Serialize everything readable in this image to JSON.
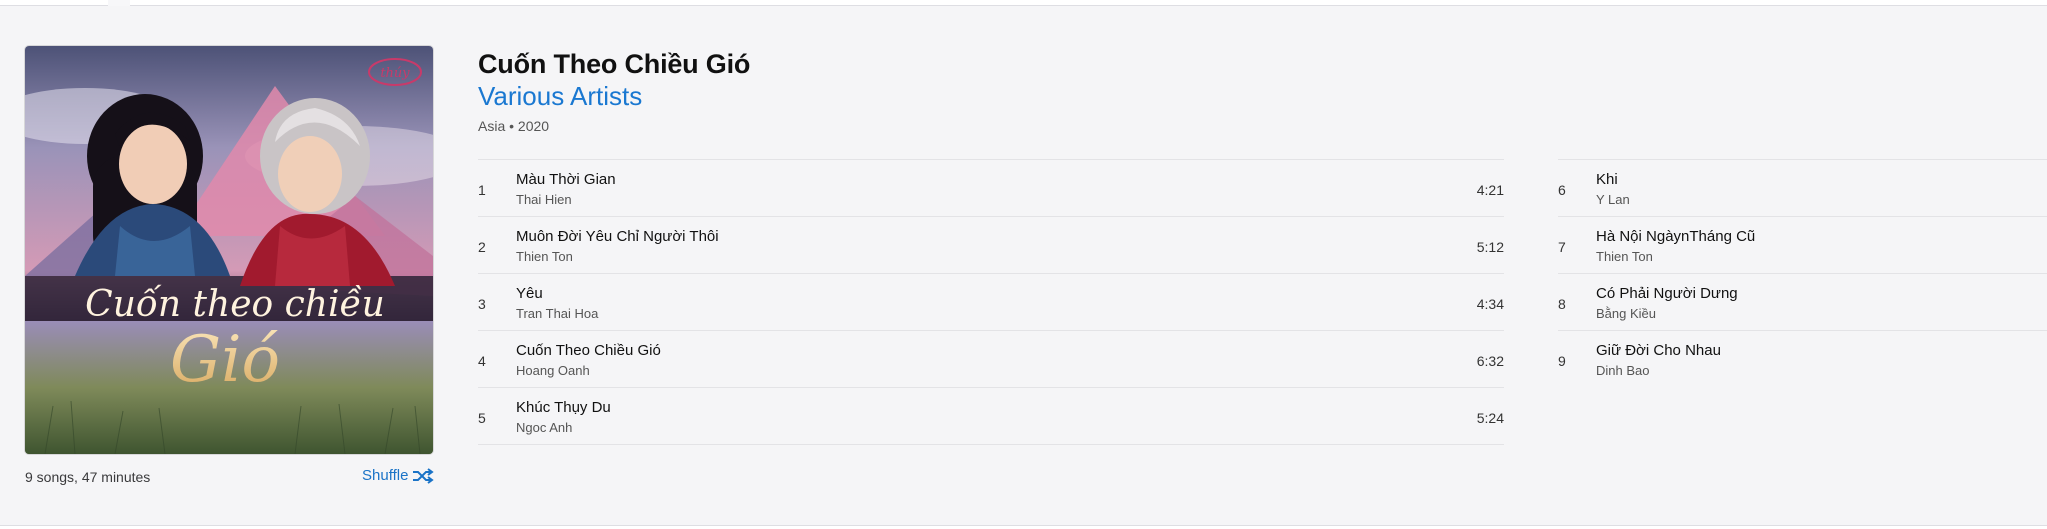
{
  "album": {
    "title": "Cuốn Theo Chiều Gió",
    "artist": "Various Artists",
    "meta": "Asia • 2020",
    "summary": "9 songs, 47 minutes",
    "shuffle_label": "Shuffle",
    "cover": {
      "logo_text": "thúy",
      "script_line1": "Cuốn theo chiều",
      "script_line2": "Gió",
      "colors": {
        "sky_top": "#6c6f9a",
        "sky_mid": "#c98aa8",
        "mountain": "#e58fb0",
        "grass": "#7c8a52",
        "gold": "#f1d39a"
      }
    }
  },
  "colors": {
    "accent": "#1a78d1",
    "background": "#f5f5f7"
  },
  "tracks_left": [
    {
      "num": "1",
      "title": "Màu Thời Gian",
      "artist": "Thai Hien",
      "duration": "4:21"
    },
    {
      "num": "2",
      "title": "Muôn Đời Yêu Chỉ Người Thôi",
      "artist": "Thien Ton",
      "duration": "5:12"
    },
    {
      "num": "3",
      "title": "Yêu",
      "artist": "Tran Thai Hoa",
      "duration": "4:34"
    },
    {
      "num": "4",
      "title": "Cuốn Theo Chiều Gió",
      "artist": "Hoang Oanh",
      "duration": "6:32"
    },
    {
      "num": "5",
      "title": "Khúc Thụy Du",
      "artist": "Ngoc Anh",
      "duration": "5:24"
    }
  ],
  "tracks_right": [
    {
      "num": "6",
      "title": "Khi",
      "artist": "Y Lan"
    },
    {
      "num": "7",
      "title": "Hà Nội NgàynTháng Cũ",
      "artist": "Thien Ton"
    },
    {
      "num": "8",
      "title": "Có Phải Người Dưng",
      "artist": "Bằng Kiều"
    },
    {
      "num": "9",
      "title": "Giữ Đời Cho Nhau",
      "artist": "Dinh Bao"
    }
  ]
}
